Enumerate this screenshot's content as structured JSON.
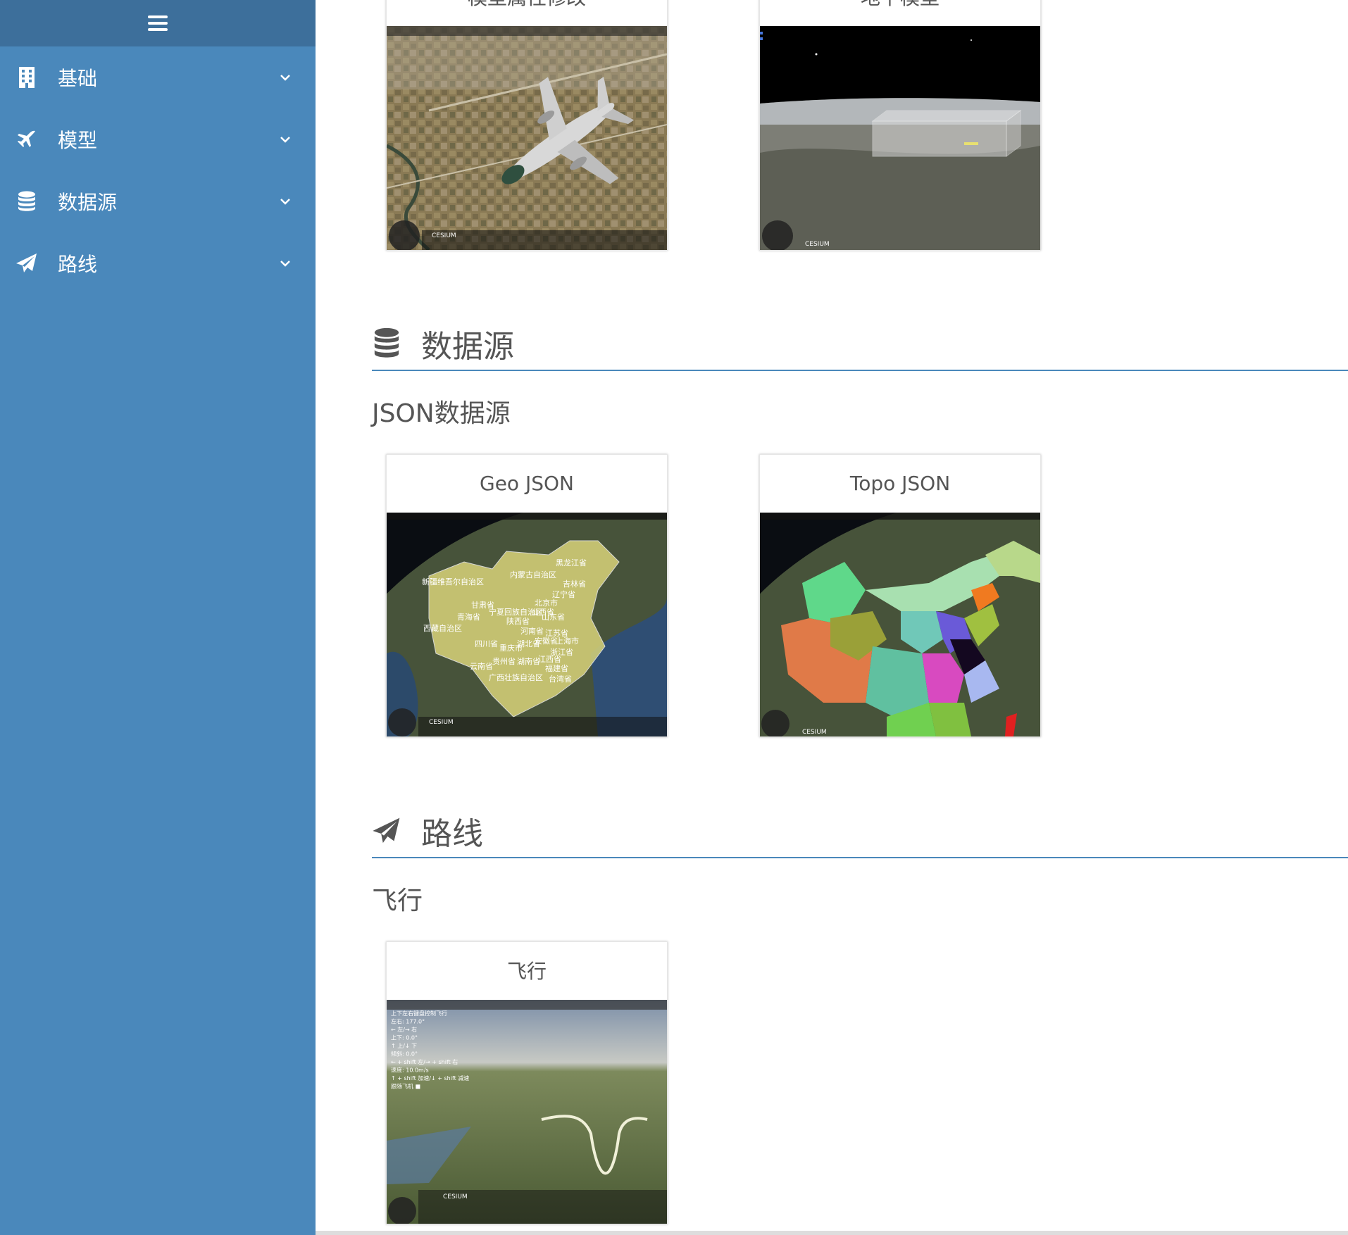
{
  "sidebar": {
    "items": [
      {
        "label": "基础",
        "icon": "building-icon"
      },
      {
        "label": "模型",
        "icon": "plane-icon"
      },
      {
        "label": "数据源",
        "icon": "database-icon"
      },
      {
        "label": "路线",
        "icon": "paper-plane-icon"
      }
    ]
  },
  "cards_top": [
    {
      "title": "模型属性修改"
    },
    {
      "title": "地下模型"
    }
  ],
  "sections": [
    {
      "title": "数据源",
      "subtitle": "JSON数据源",
      "cards": [
        {
          "title": "Geo JSON"
        },
        {
          "title": "Topo JSON"
        }
      ]
    },
    {
      "title": "路线",
      "subtitle": "飞行",
      "cards": [
        {
          "title": "飞行"
        }
      ]
    }
  ],
  "thumb_text": {
    "cesium": "CESIUM",
    "geo_labels": [
      "内蒙古自治区",
      "黑龙江省",
      "新疆维吾尔自治区",
      "吉林省",
      "甘肃省",
      "辽宁省",
      "宁夏回族自治区",
      "北京市",
      "青海省",
      "山西省",
      "陕西省",
      "山东省",
      "西藏自治区",
      "河南省",
      "江苏省",
      "四川省",
      "重庆市",
      "湖北省",
      "安徽省",
      "上海市",
      "浙江省",
      "贵州省",
      "湖南省",
      "江西省",
      "云南省",
      "福建省",
      "广西壮族自治区",
      "台湾省"
    ],
    "flight_lines": [
      "上下左右键盘控制飞行",
      "左右: 177.0°",
      "← 左/→ 右",
      "上下: 0.0°",
      "↑ 上/↓ 下",
      "倾斜: 0.0°",
      "← + shift 左/→ + shift 右",
      "速度: 10.0m/s",
      "↑ + shift 加速/↓ + shift 减速",
      "跟随飞机 ■"
    ]
  },
  "colors": {
    "sidebar": "#4a88bb",
    "sidebar_top": "#3d6f9b",
    "accent": "#4a88bb"
  }
}
